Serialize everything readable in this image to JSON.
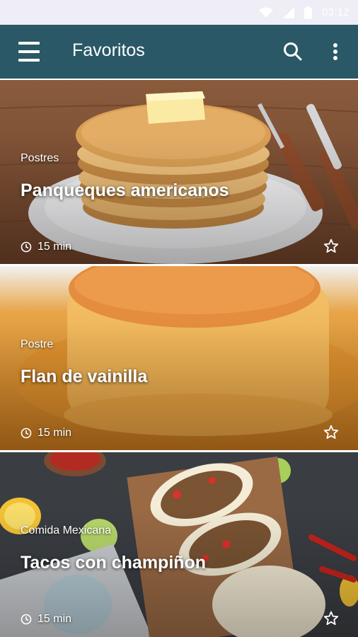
{
  "status_bar": {
    "time": "03:12"
  },
  "app_bar": {
    "title": "Favoritos"
  },
  "recipes": [
    {
      "category": "Postres",
      "name": "Panqueques americanos",
      "time": "15 min"
    },
    {
      "category": "Postre",
      "name": "Flan de vainilla",
      "time": "15 min"
    },
    {
      "category": "Comida Mexicana",
      "name": "Tacos con champiñon",
      "time": "15 min"
    }
  ],
  "colors": {
    "app_bar": "#2a5866",
    "status_bar": "#efedf5",
    "text": "#ffffff"
  }
}
